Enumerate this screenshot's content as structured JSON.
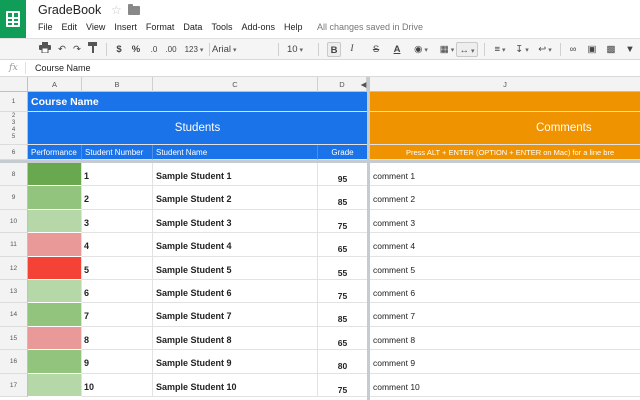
{
  "app": {
    "title": "GradeBook",
    "save_status": "All changes saved in Drive",
    "menu": [
      "File",
      "Edit",
      "View",
      "Insert",
      "Format",
      "Data",
      "Tools",
      "Add-ons",
      "Help"
    ]
  },
  "toolbar": {
    "currency": "$",
    "percent": "%",
    "decrease_decimals": ".0",
    "increase_decimals": ".00",
    "more_formats": "123",
    "font": "Arial",
    "font_size": "10",
    "bold": "B",
    "italic": "I",
    "strike": "S",
    "text_color": "A"
  },
  "formula_bar": {
    "fx": "fx",
    "content": "Course Name"
  },
  "columns": [
    "A",
    "B",
    "C",
    "D",
    "J"
  ],
  "header_rows": {
    "row1_title": "Course Name",
    "students_banner": "Students",
    "comments_banner": "Comments",
    "col_labels": [
      "Performance",
      "Student Number",
      "Student Name",
      "Grade"
    ],
    "comments_hint": "Press ALT + ENTER (OPTION + ENTER on Mac) for a line bre",
    "row_numbers": [
      "1",
      "2",
      "3",
      "4",
      "5",
      "6"
    ]
  },
  "rows": [
    {
      "row": "8",
      "number": "1",
      "name": "Sample Student 1",
      "grade": "95",
      "comment": "comment 1",
      "perf_color": "#6aa84f"
    },
    {
      "row": "9",
      "number": "2",
      "name": "Sample Student 2",
      "grade": "85",
      "comment": "comment 2",
      "perf_color": "#93c47d"
    },
    {
      "row": "10",
      "number": "3",
      "name": "Sample Student 3",
      "grade": "75",
      "comment": "comment 3",
      "perf_color": "#b6d7a8"
    },
    {
      "row": "11",
      "number": "4",
      "name": "Sample Student 4",
      "grade": "65",
      "comment": "comment 4",
      "perf_color": "#ea9999"
    },
    {
      "row": "12",
      "number": "5",
      "name": "Sample Student 5",
      "grade": "55",
      "comment": "comment 5",
      "perf_color": "#f44336"
    },
    {
      "row": "13",
      "number": "6",
      "name": "Sample Student 6",
      "grade": "75",
      "comment": "comment 6",
      "perf_color": "#b6d7a8"
    },
    {
      "row": "14",
      "number": "7",
      "name": "Sample Student 7",
      "grade": "85",
      "comment": "comment 7",
      "perf_color": "#93c47d"
    },
    {
      "row": "15",
      "number": "8",
      "name": "Sample Student 8",
      "grade": "65",
      "comment": "comment 8",
      "perf_color": "#ea9999"
    },
    {
      "row": "16",
      "number": "9",
      "name": "Sample Student 9",
      "grade": "80",
      "comment": "comment 9",
      "perf_color": "#93c47d"
    },
    {
      "row": "17",
      "number": "10",
      "name": "Sample Student 10",
      "grade": "75",
      "comment": "comment 10",
      "perf_color": "#b6d7a8"
    }
  ],
  "colors": {
    "header_blue": "#1a73e8",
    "header_orange": "#f09300",
    "sheets_green": "#0f9d58"
  }
}
